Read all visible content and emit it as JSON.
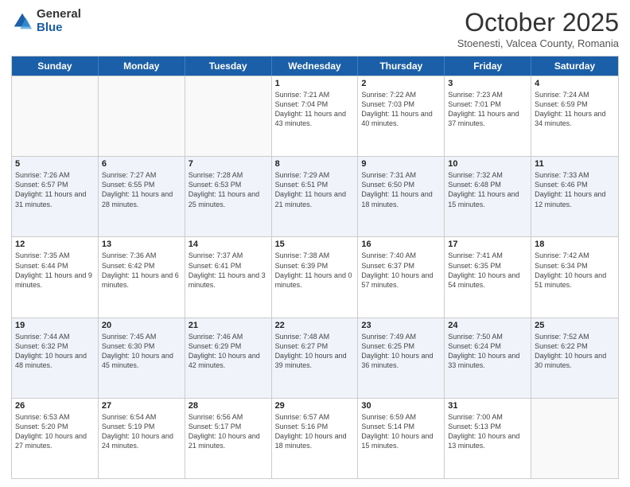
{
  "logo": {
    "general": "General",
    "blue": "Blue"
  },
  "header": {
    "month": "October 2025",
    "location": "Stoenesti, Valcea County, Romania"
  },
  "days": [
    "Sunday",
    "Monday",
    "Tuesday",
    "Wednesday",
    "Thursday",
    "Friday",
    "Saturday"
  ],
  "weeks": [
    [
      {
        "day": "",
        "info": ""
      },
      {
        "day": "",
        "info": ""
      },
      {
        "day": "",
        "info": ""
      },
      {
        "day": "1",
        "info": "Sunrise: 7:21 AM\nSunset: 7:04 PM\nDaylight: 11 hours and 43 minutes."
      },
      {
        "day": "2",
        "info": "Sunrise: 7:22 AM\nSunset: 7:03 PM\nDaylight: 11 hours and 40 minutes."
      },
      {
        "day": "3",
        "info": "Sunrise: 7:23 AM\nSunset: 7:01 PM\nDaylight: 11 hours and 37 minutes."
      },
      {
        "day": "4",
        "info": "Sunrise: 7:24 AM\nSunset: 6:59 PM\nDaylight: 11 hours and 34 minutes."
      }
    ],
    [
      {
        "day": "5",
        "info": "Sunrise: 7:26 AM\nSunset: 6:57 PM\nDaylight: 11 hours and 31 minutes."
      },
      {
        "day": "6",
        "info": "Sunrise: 7:27 AM\nSunset: 6:55 PM\nDaylight: 11 hours and 28 minutes."
      },
      {
        "day": "7",
        "info": "Sunrise: 7:28 AM\nSunset: 6:53 PM\nDaylight: 11 hours and 25 minutes."
      },
      {
        "day": "8",
        "info": "Sunrise: 7:29 AM\nSunset: 6:51 PM\nDaylight: 11 hours and 21 minutes."
      },
      {
        "day": "9",
        "info": "Sunrise: 7:31 AM\nSunset: 6:50 PM\nDaylight: 11 hours and 18 minutes."
      },
      {
        "day": "10",
        "info": "Sunrise: 7:32 AM\nSunset: 6:48 PM\nDaylight: 11 hours and 15 minutes."
      },
      {
        "day": "11",
        "info": "Sunrise: 7:33 AM\nSunset: 6:46 PM\nDaylight: 11 hours and 12 minutes."
      }
    ],
    [
      {
        "day": "12",
        "info": "Sunrise: 7:35 AM\nSunset: 6:44 PM\nDaylight: 11 hours and 9 minutes."
      },
      {
        "day": "13",
        "info": "Sunrise: 7:36 AM\nSunset: 6:42 PM\nDaylight: 11 hours and 6 minutes."
      },
      {
        "day": "14",
        "info": "Sunrise: 7:37 AM\nSunset: 6:41 PM\nDaylight: 11 hours and 3 minutes."
      },
      {
        "day": "15",
        "info": "Sunrise: 7:38 AM\nSunset: 6:39 PM\nDaylight: 11 hours and 0 minutes."
      },
      {
        "day": "16",
        "info": "Sunrise: 7:40 AM\nSunset: 6:37 PM\nDaylight: 10 hours and 57 minutes."
      },
      {
        "day": "17",
        "info": "Sunrise: 7:41 AM\nSunset: 6:35 PM\nDaylight: 10 hours and 54 minutes."
      },
      {
        "day": "18",
        "info": "Sunrise: 7:42 AM\nSunset: 6:34 PM\nDaylight: 10 hours and 51 minutes."
      }
    ],
    [
      {
        "day": "19",
        "info": "Sunrise: 7:44 AM\nSunset: 6:32 PM\nDaylight: 10 hours and 48 minutes."
      },
      {
        "day": "20",
        "info": "Sunrise: 7:45 AM\nSunset: 6:30 PM\nDaylight: 10 hours and 45 minutes."
      },
      {
        "day": "21",
        "info": "Sunrise: 7:46 AM\nSunset: 6:29 PM\nDaylight: 10 hours and 42 minutes."
      },
      {
        "day": "22",
        "info": "Sunrise: 7:48 AM\nSunset: 6:27 PM\nDaylight: 10 hours and 39 minutes."
      },
      {
        "day": "23",
        "info": "Sunrise: 7:49 AM\nSunset: 6:25 PM\nDaylight: 10 hours and 36 minutes."
      },
      {
        "day": "24",
        "info": "Sunrise: 7:50 AM\nSunset: 6:24 PM\nDaylight: 10 hours and 33 minutes."
      },
      {
        "day": "25",
        "info": "Sunrise: 7:52 AM\nSunset: 6:22 PM\nDaylight: 10 hours and 30 minutes."
      }
    ],
    [
      {
        "day": "26",
        "info": "Sunrise: 6:53 AM\nSunset: 5:20 PM\nDaylight: 10 hours and 27 minutes."
      },
      {
        "day": "27",
        "info": "Sunrise: 6:54 AM\nSunset: 5:19 PM\nDaylight: 10 hours and 24 minutes."
      },
      {
        "day": "28",
        "info": "Sunrise: 6:56 AM\nSunset: 5:17 PM\nDaylight: 10 hours and 21 minutes."
      },
      {
        "day": "29",
        "info": "Sunrise: 6:57 AM\nSunset: 5:16 PM\nDaylight: 10 hours and 18 minutes."
      },
      {
        "day": "30",
        "info": "Sunrise: 6:59 AM\nSunset: 5:14 PM\nDaylight: 10 hours and 15 minutes."
      },
      {
        "day": "31",
        "info": "Sunrise: 7:00 AM\nSunset: 5:13 PM\nDaylight: 10 hours and 13 minutes."
      },
      {
        "day": "",
        "info": ""
      }
    ]
  ]
}
